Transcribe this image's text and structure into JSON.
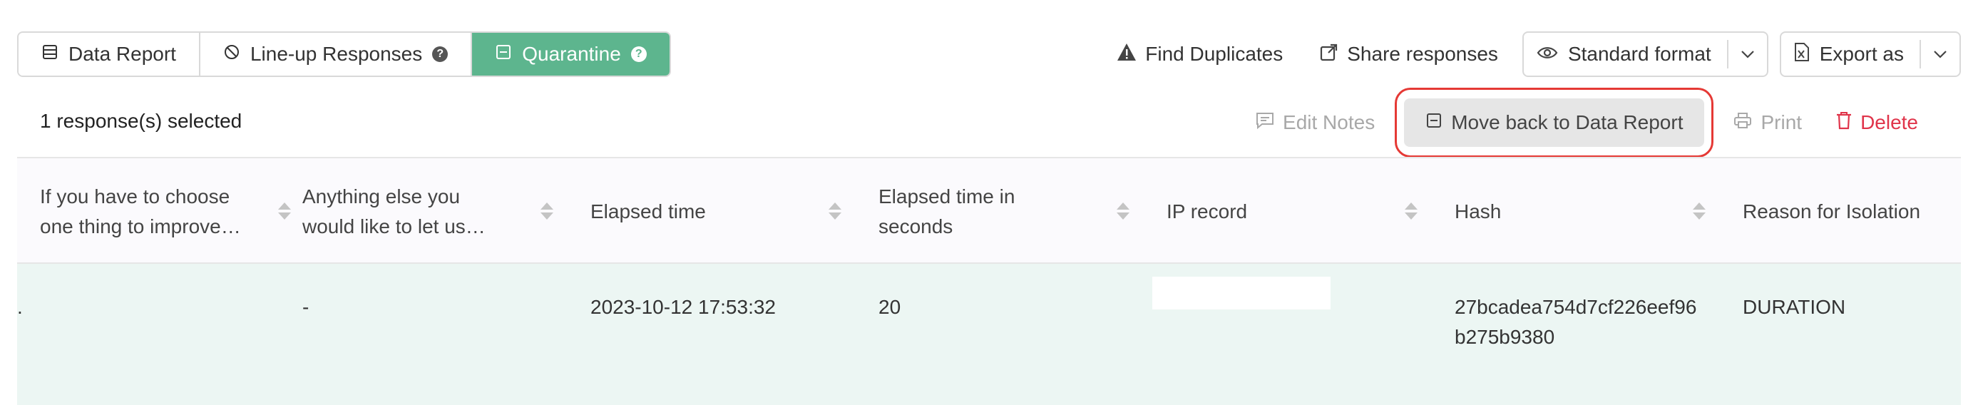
{
  "tabs": [
    {
      "label": "Data Report",
      "icon": "table-icon"
    },
    {
      "label": "Line-up Responses",
      "icon": "ban-icon",
      "help": "?"
    },
    {
      "label": "Quarantine",
      "icon": "minus-square-icon",
      "help": "?"
    }
  ],
  "toolbar": {
    "find_duplicates": "Find Duplicates",
    "share_responses": "Share responses",
    "standard_format": "Standard format",
    "export_as": "Export as"
  },
  "selection": {
    "count_text": "1 response(s) selected",
    "edit_notes": "Edit Notes",
    "move_back": "Move back to Data Report",
    "print": "Print",
    "delete": "Delete"
  },
  "colors": {
    "accent": "#5db58e",
    "danger": "#e0344a",
    "highlight": "#e53935",
    "row_bg": "#ecf6f3"
  },
  "table": {
    "columns": [
      "If you have to choose one thing to improve…",
      "Anything else you would like to let us…",
      "Elapsed time",
      "Elapsed time in seconds",
      "IP record",
      "Hash",
      "Reason for Isolation"
    ],
    "rows": [
      {
        "lead": ".",
        "improve": "",
        "anything_else": "-",
        "elapsed_time": "2023-10-12 17:53:32",
        "elapsed_seconds": "20",
        "ip": "",
        "hash": "27bcadea754d7cf226eef96b275b9380",
        "reason": "DURATION"
      }
    ]
  }
}
